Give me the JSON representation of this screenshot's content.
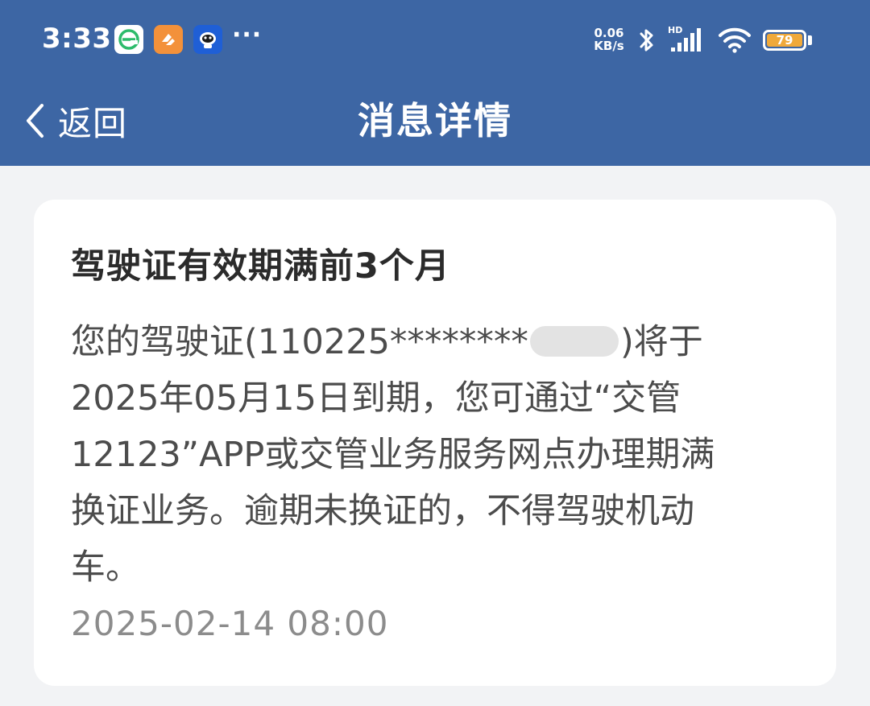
{
  "status_bar": {
    "time": "3:33",
    "more_indicator": "···",
    "net_speed_value": "0.06",
    "net_speed_unit": "KB/s",
    "signal_label": "HD",
    "battery_level": "79",
    "app_icons": [
      "browser-icon",
      "orange-app-icon",
      "robot-app-icon"
    ],
    "colors": {
      "bar": "#3d66a4",
      "battery": "#f0a93a"
    }
  },
  "nav": {
    "back_label": "返回",
    "title": "消息详情"
  },
  "message": {
    "title": "驾驶证有效期满前3个月",
    "body_line1_prefix": "您的驾驶证(110225********",
    "body_line1_suffix": ")将于",
    "body_line2": "2025年05月15日到期，您可通过“交管",
    "body_line3": "12123”APP或交管业务服务网点办理期满",
    "body_line4": "换证业务。逾期未换证的，不得驾驶机动",
    "body_line5": "车。",
    "timestamp": "2025-02-14 08:00"
  }
}
